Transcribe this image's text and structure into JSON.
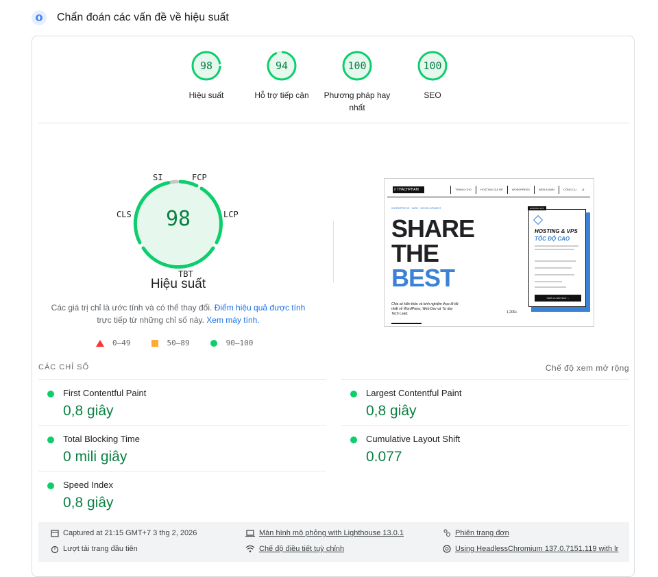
{
  "header": {
    "title": "Chẩn đoán các vấn đề về hiệu suất",
    "icon": "lighthouse-icon"
  },
  "scores": [
    {
      "value": "98",
      "fraction": 0.98,
      "label": "Hiệu suất"
    },
    {
      "value": "94",
      "fraction": 0.94,
      "label": "Hỗ trợ tiếp cận"
    },
    {
      "value": "100",
      "fraction": 1.0,
      "label": "Phương pháp hay nhất"
    },
    {
      "value": "100",
      "fraction": 1.0,
      "label": "SEO"
    }
  ],
  "performance": {
    "score": "98",
    "title": "Hiệu suất",
    "metric_labels": {
      "si": "SI",
      "fcp": "FCP",
      "lcp": "LCP",
      "tbt": "TBT",
      "cls": "CLS"
    },
    "note_text": "Các giá trị chỉ là ước tính và có thể thay đổi.",
    "note_link": "Điểm hiệu quả được tính",
    "note_text2": "trực tiếp từ những chỉ số này.",
    "note_link2": "Xem máy tính."
  },
  "legend": {
    "fail": "0–49",
    "average": "50–89",
    "pass": "90–100"
  },
  "screenshot": {
    "logo": "// THACHPHAM",
    "nav": [
      "TRANG CHỦ",
      "HOSTING GIÁ RẺ",
      "WORDPRESS",
      "WEB ADMIN",
      "CÔNG CỤ"
    ],
    "tiny": "WORDPRESS · WEB · DEVELOPMENT",
    "hero": [
      "SHARE",
      "THE",
      "BEST"
    ],
    "desc": "Chia sẻ kiến thức và kinh nghiệm thực tế tốt nhất về WordPress, Web Dev và Tư duy Tech Lead.",
    "stat_value": "1,200+",
    "box_tag": "HOSTING VPS",
    "box_title1": "HOSTING & VPS",
    "box_title2": "TỐC ĐỘ CAO",
    "box_button": "NHẬN ƯU ĐÃI NGAY →"
  },
  "metrics": {
    "heading": "CÁC CHỈ SỐ",
    "expand": "Chế độ xem mở rộng",
    "items": [
      {
        "name": "First Contentful Paint",
        "value": "0,8 giây"
      },
      {
        "name": "Largest Contentful Paint",
        "value": "0,8 giây"
      },
      {
        "name": "Total Blocking Time",
        "value": "0 mili giây"
      },
      {
        "name": "Cumulative Layout Shift",
        "value": "0.077"
      },
      {
        "name": "Speed Index",
        "value": "0,8 giây"
      }
    ]
  },
  "footer": {
    "captured": "Captured at 21:15 GMT+7 3 thg 2, 2026",
    "first_load": "Lượt tải trang đầu tiên",
    "emulation": "Màn hình mô phỏng with Lighthouse 13.0.1",
    "throttling": "Chế độ điều tiết tuỳ chỉnh",
    "session": "Phiên trang đơn",
    "browser": "Using HeadlessChromium 137.0.7151.119 with lr"
  },
  "colors": {
    "pass": "#0cce6b",
    "pass_text": "#0b8043",
    "average": "#ffaa33",
    "fail": "#ff3333",
    "link": "#1a73e8"
  }
}
